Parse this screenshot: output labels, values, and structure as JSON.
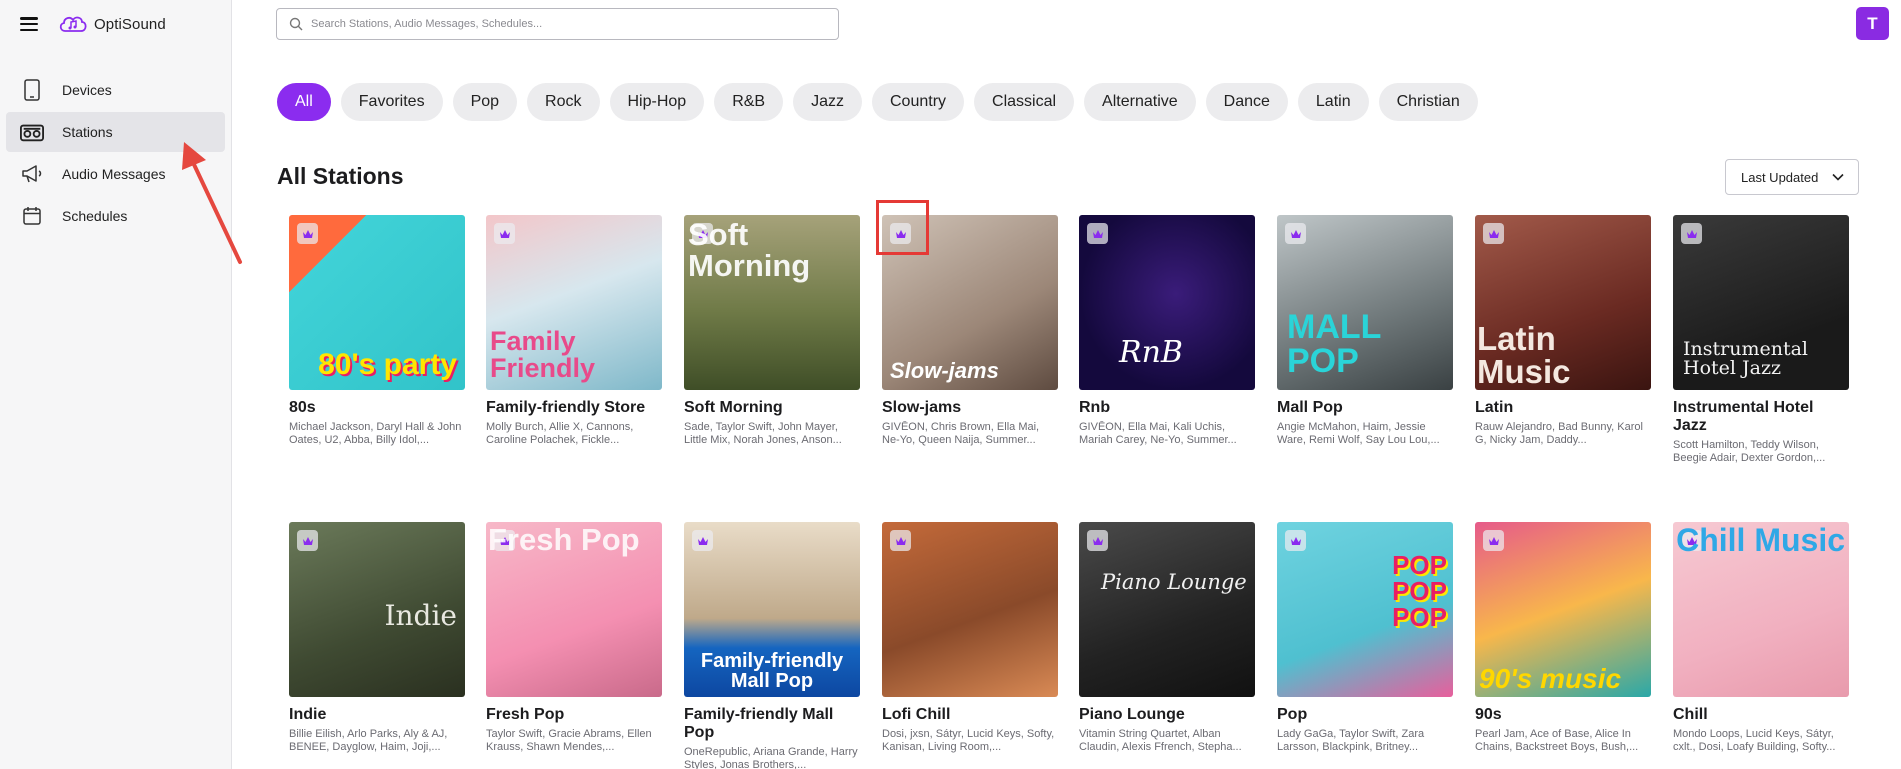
{
  "app": {
    "name": "OptiSound",
    "avatar_letter": "T"
  },
  "sidebar": {
    "items": [
      {
        "label": "Devices",
        "icon": "tablet-icon",
        "active": false
      },
      {
        "label": "Stations",
        "icon": "radio-icon",
        "active": true
      },
      {
        "label": "Audio Messages",
        "icon": "megaphone-icon",
        "active": false
      },
      {
        "label": "Schedules",
        "icon": "calendar-icon",
        "active": false
      }
    ]
  },
  "search": {
    "placeholder": "Search Stations, Audio Messages, Schedules..."
  },
  "genres": [
    "All",
    "Favorites",
    "Pop",
    "Rock",
    "Hip-Hop",
    "R&B",
    "Jazz",
    "Country",
    "Classical",
    "Alternative",
    "Dance",
    "Latin",
    "Christian"
  ],
  "active_genre": "All",
  "section": {
    "title": "All Stations",
    "sort_label": "Last Updated"
  },
  "stations": [
    {
      "title": "80s",
      "artists": "Michael Jackson, Daryl Hall & John Oates, U2, Abba, Billy Idol,...",
      "art_text": "80's party",
      "premium": true
    },
    {
      "title": "Family-friendly Store",
      "artists": "Molly Burch, Allie X, Cannons, Caroline Polachek, Fickle...",
      "art_text": "Family Friendly",
      "premium": true
    },
    {
      "title": "Soft Morning",
      "artists": "Sade, Taylor Swift, John Mayer, Little Mix, Norah Jones, Anson...",
      "art_text": "Soft Morning",
      "premium": true
    },
    {
      "title": "Slow-jams",
      "artists": "GIVĒON, Chris Brown, Ella Mai, Ne-Yo, Queen Naija, Summer...",
      "art_text": "Slow-jams",
      "premium": true
    },
    {
      "title": "Rnb",
      "artists": "GIVĒON, Ella Mai, Kali Uchis, Mariah Carey, Ne-Yo, Summer...",
      "art_text": "RnB",
      "premium": true
    },
    {
      "title": "Mall Pop",
      "artists": "Angie McMahon, Haim, Jessie Ware, Remi Wolf, Say Lou Lou,...",
      "art_text": "MALL POP",
      "premium": true
    },
    {
      "title": "Latin",
      "artists": "Rauw Alejandro, Bad Bunny, Karol G, Nicky Jam, Daddy...",
      "art_text": "Latin Music",
      "premium": true
    },
    {
      "title": "Instrumental Hotel Jazz",
      "artists": "Scott Hamilton, Teddy Wilson, Beegie Adair, Dexter Gordon,...",
      "art_text": "Instrumental Hotel Jazz",
      "premium": true
    },
    {
      "title": "Indie",
      "artists": "Billie Eilish, Arlo Parks, Aly & AJ, BENEE, Dayglow, Haim, Joji,...",
      "art_text": "Indie",
      "premium": true
    },
    {
      "title": "Fresh Pop",
      "artists": "Taylor Swift, Gracie Abrams, Ellen Krauss, Shawn Mendes,...",
      "art_text": "Fresh Pop",
      "premium": true
    },
    {
      "title": "Family-friendly Mall Pop",
      "artists": "OneRepublic, Ariana Grande, Harry Styles, Jonas Brothers,...",
      "art_text": "Family-friendly Mall Pop",
      "premium": true
    },
    {
      "title": "Lofi Chill",
      "artists": "Dosi, jxsn, Sátyr, Lucid Keys, Softy, Kanisan, Living Room,...",
      "art_text": "",
      "premium": true
    },
    {
      "title": "Piano Lounge",
      "artists": "Vitamin String Quartet, Alban Claudin, Alexis Ffrench, Stepha...",
      "art_text": "Piano Lounge",
      "premium": true
    },
    {
      "title": "Pop",
      "artists": "Lady GaGa, Taylor Swift, Zara Larsson, Blackpink, Britney...",
      "art_text": "POP POP POP",
      "premium": true
    },
    {
      "title": "90s",
      "artists": "Pearl Jam, Ace of Base, Alice In Chains, Backstreet Boys, Bush,...",
      "art_text": "90's music",
      "premium": true
    },
    {
      "title": "Chill",
      "artists": "Mondo Loops, Lucid Keys, Sátyr, cxlt., Dosi, Loafy Building, Softy...",
      "art_text": "Chill Music",
      "premium": true
    }
  ],
  "colors": {
    "accent": "#8b2cef",
    "avatar": "#8a2be2",
    "annotation": "#e53935"
  }
}
